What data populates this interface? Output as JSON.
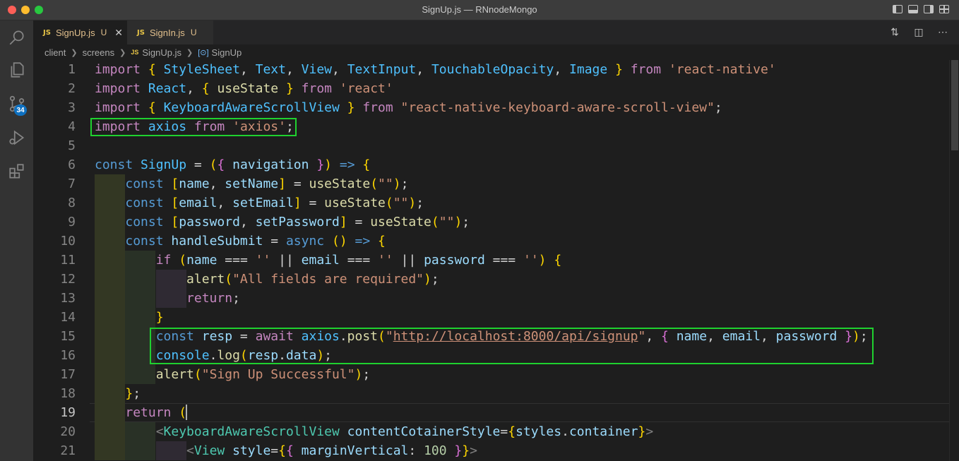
{
  "window": {
    "title": "SignUp.js — RNnodeMongo"
  },
  "activity_bar": {
    "source_control_badge": "34",
    "items": [
      "search-icon",
      "files-icon",
      "source-control-icon",
      "run-debug-icon",
      "extensions-icon"
    ]
  },
  "tabs": [
    {
      "icon": "JS",
      "label": "SignUp.js",
      "status": "U",
      "close": "✕"
    },
    {
      "icon": "JS",
      "label": "SignIn.js",
      "status": "U"
    }
  ],
  "breadcrumb": {
    "parts": [
      "client",
      "screens",
      "SignUp.js",
      "SignUp"
    ],
    "js_badge": "JS",
    "symbol_glyph": "[⊙]"
  },
  "editor": {
    "line_numbers": [
      "1",
      "2",
      "3",
      "4",
      "5",
      "6",
      "7",
      "8",
      "9",
      "10",
      "11",
      "12",
      "13",
      "14",
      "15",
      "16",
      "17",
      "18",
      "19",
      "20",
      "21"
    ],
    "current_line": "19",
    "lines": [
      "import { StyleSheet, Text, View, TextInput, TouchableOpacity, Image } from 'react-native'",
      "import React, { useState } from 'react'",
      "import { KeyboardAwareScrollView } from \"react-native-keyboard-aware-scroll-view\";",
      "import axios from 'axios';",
      "",
      "const SignUp = ({ navigation }) => {",
      "    const [name, setName] = useState(\"\");",
      "    const [email, setEmail] = useState(\"\");",
      "    const [password, setPassword] = useState(\"\");",
      "    const handleSubmit = async () => {",
      "        if (name === '' || email === '' || password === '') {",
      "            alert(\"All fields are required\");",
      "            return;",
      "        }",
      "        const resp = await axios.post(\"http://localhost:8000/api/signup\", { name, email, password });",
      "        console.log(resp.data);",
      "        alert(\"Sign Up Successful\");",
      "    };",
      "    return (",
      "        <KeyboardAwareScrollView contentCotainerStyle={styles.container}>",
      "            <View style={{ marginVertical: 100 }}>"
    ]
  },
  "colors": {
    "highlight_box": "#1fd12f",
    "badge": "#0e70c0",
    "modified_tab": "#e2c08d"
  }
}
